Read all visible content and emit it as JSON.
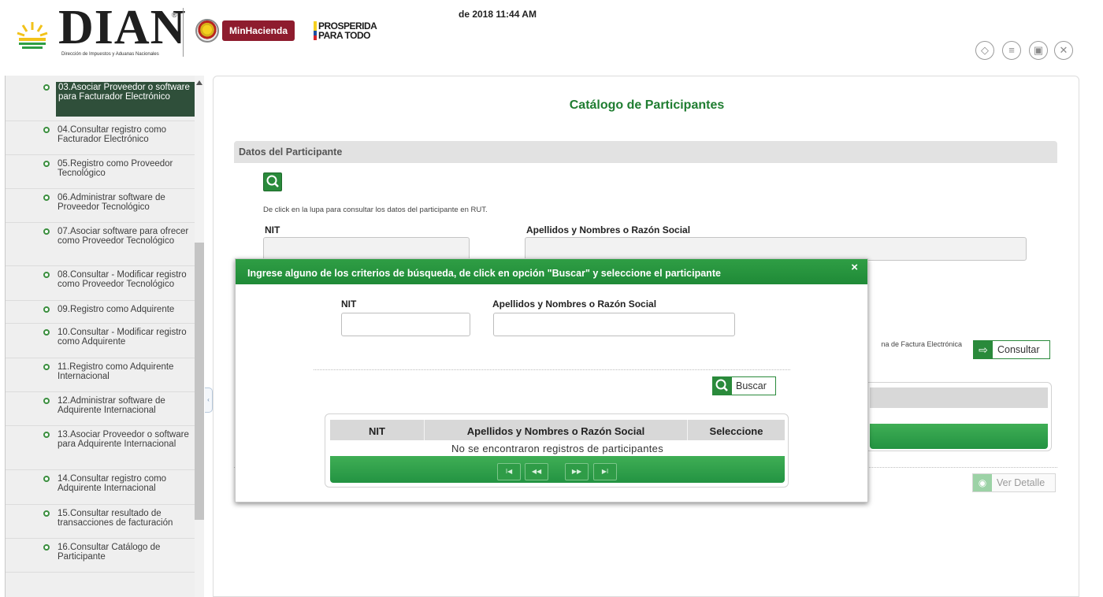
{
  "header": {
    "logo_text": "DIAN",
    "logo_registered": "®",
    "logo_subtitle": "Dirección de Impuestos y Aduanas Nacionales",
    "ministry_logo_text": "MinHacienda",
    "slogan_line1": "PROSPERIDA",
    "slogan_line2": "PARA TODO",
    "datetime": "de 2018 11:44 AM",
    "tools": [
      {
        "icon": "tag-icon",
        "glyph": "◇"
      },
      {
        "icon": "list-icon",
        "glyph": "≡"
      },
      {
        "icon": "print-icon",
        "glyph": "▣"
      },
      {
        "icon": "close-circle-icon",
        "glyph": "✕"
      }
    ]
  },
  "sidebar": {
    "items": [
      {
        "label": "03.Asociar Proveedor o software para Facturador Electrónico",
        "active": true
      },
      {
        "label": "04.Consultar registro como Facturador Electrónico"
      },
      {
        "label": "05.Registro como Proveedor Tecnológico"
      },
      {
        "label": "06.Administrar software de Proveedor Tecnológico"
      },
      {
        "label": "07.Asociar software para ofrecer como Proveedor Tecnológico"
      },
      {
        "label": "08.Consultar - Modificar registro como Proveedor Tecnológico"
      },
      {
        "label": "09.Registro como Adquirente"
      },
      {
        "label": "10.Consultar - Modificar registro como Adquirente"
      },
      {
        "label": "11.Registro como Adquirente Internacional"
      },
      {
        "label": "12.Administrar software de Adquirente Internacional"
      },
      {
        "label": "13.Asociar Proveedor o software para Adquirente Internacional"
      },
      {
        "label": "14.Consultar registro como Adquirente Internacional"
      },
      {
        "label": "15.Consultar resultado de transacciones de facturación"
      },
      {
        "label": "16.Consultar Catálogo de Participante"
      }
    ]
  },
  "main": {
    "title": "Catálogo de Participantes",
    "section_title": "Datos del Participante",
    "rut_hint": "De click en la lupa para consultar los datos del participante en RUT.",
    "nit_label": "NIT",
    "razon_label": "Apellidos y Nombres o Razón Social",
    "consultar_note": "na de Factura Electrónica",
    "consultar_label": "Consultar",
    "ver_detalle_label": "Ver Detalle"
  },
  "modal": {
    "title": "Ingrese alguno de los criterios de búsqueda, de click en opción \"Buscar\" y seleccione el participante",
    "close_glyph": "×",
    "nit_label": "NIT",
    "razon_label": "Apellidos y Nombres o Razón Social",
    "nit_value": "",
    "razon_value": "",
    "buscar_label": "Buscar",
    "grid": {
      "columns": [
        "NIT",
        "Apellidos y Nombres o Razón Social",
        "Seleccione"
      ],
      "empty_message": "No se encontraron registros de participantes",
      "pager": [
        {
          "name": "first-page-button",
          "glyph": "I◀"
        },
        {
          "name": "prev-page-button",
          "glyph": "◀◀"
        },
        {
          "name": "next-page-button",
          "glyph": "▶▶"
        },
        {
          "name": "last-page-button",
          "glyph": "▶I"
        }
      ]
    }
  },
  "colors": {
    "brand_green": "#2a8a3b",
    "modal_header_green": "#1f8a37",
    "active_menu_bg": "#2f4f3a",
    "title_green": "#1f7d31"
  }
}
